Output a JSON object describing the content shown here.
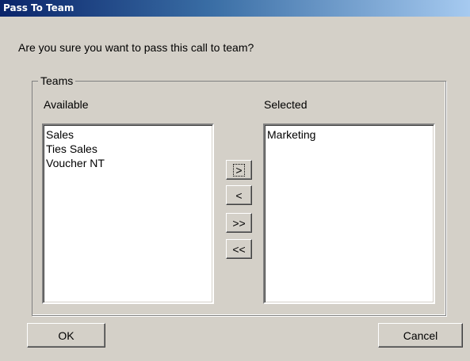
{
  "window": {
    "title": "Pass To Team"
  },
  "prompt": "Are you sure you want to pass this call to team?",
  "teams_group": {
    "legend": "Teams",
    "available_label": "Available",
    "selected_label": "Selected",
    "available_items": [
      "Sales",
      "Ties Sales",
      "Voucher NT"
    ],
    "selected_items": [
      "Marketing"
    ]
  },
  "transfer_buttons": {
    "add": ">",
    "remove": "<",
    "add_all": ">>",
    "remove_all": "<<"
  },
  "footer": {
    "ok_label": "OK",
    "cancel_label": "Cancel"
  }
}
